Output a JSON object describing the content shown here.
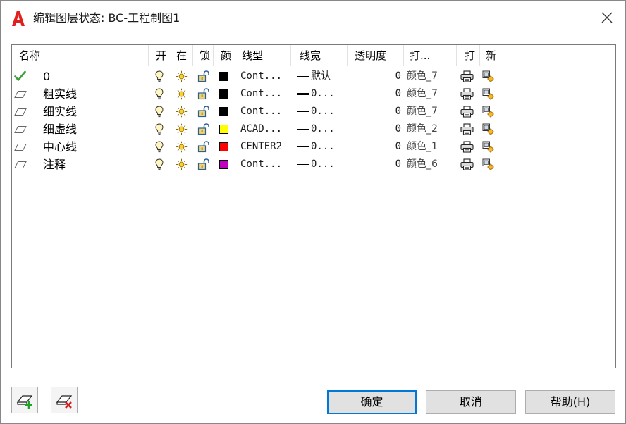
{
  "window": {
    "title": "编辑图层状态: BC-工程制图1"
  },
  "columns": {
    "name": "名称",
    "on": "开",
    "freeze": "在",
    "lock": "锁",
    "color": "颜",
    "linetype": "线型",
    "lineweight": "线宽",
    "transparency": "透明度",
    "plotstyle": "打...",
    "plot": "打",
    "newvp": "新"
  },
  "layers": [
    {
      "name": "0",
      "current": true,
      "linetype": "Cont...",
      "lineweight": "默认",
      "lineweight_bold": false,
      "transparency": "0",
      "plotstyle": "颜色_7",
      "color": "#000000"
    },
    {
      "name": "粗实线",
      "current": false,
      "linetype": "Cont...",
      "lineweight": "0...",
      "lineweight_bold": true,
      "transparency": "0",
      "plotstyle": "颜色_7",
      "color": "#000000"
    },
    {
      "name": "细实线",
      "current": false,
      "linetype": "Cont...",
      "lineweight": "0...",
      "lineweight_bold": false,
      "transparency": "0",
      "plotstyle": "颜色_7",
      "color": "#000000"
    },
    {
      "name": "细虚线",
      "current": false,
      "linetype": "ACAD...",
      "lineweight": "0...",
      "lineweight_bold": false,
      "transparency": "0",
      "plotstyle": "颜色_2",
      "color": "#ffff00"
    },
    {
      "name": "中心线",
      "current": false,
      "linetype": "CENTER2",
      "lineweight": "0...",
      "lineweight_bold": false,
      "transparency": "0",
      "plotstyle": "颜色_1",
      "color": "#ff0000"
    },
    {
      "name": "注释",
      "current": false,
      "linetype": "Cont...",
      "lineweight": "0...",
      "lineweight_bold": false,
      "transparency": "0",
      "plotstyle": "颜色_6",
      "color": "#c000c0"
    }
  ],
  "buttons": {
    "ok": "确定",
    "cancel": "取消",
    "help": "帮助(H)"
  },
  "icons": {
    "app_logo": "autocad-logo-icon",
    "close": "close-icon",
    "current_layer": "checkmark-icon",
    "layer": "layer-sheet-icon",
    "on": "lightbulb-icon",
    "thaw": "sun-icon",
    "unlocked": "unlocked-padlock-icon",
    "plot": "printer-icon",
    "new_vp_freeze": "new-viewport-freeze-icon",
    "add_layers": "add-layers-icon",
    "remove_layers": "remove-layers-icon"
  },
  "colors": {
    "accent": "#0078d7",
    "brand": "#e1201e"
  }
}
